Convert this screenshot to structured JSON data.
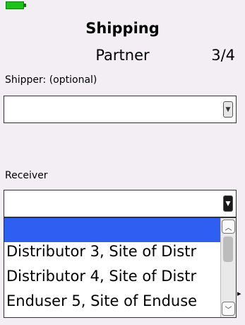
{
  "status": {
    "battery_color": "#19c419"
  },
  "header": {
    "title": "Shipping",
    "subtitle": "Partner",
    "page_indicator": "3/4"
  },
  "shipper": {
    "label": "Shipper: (optional)",
    "value": ""
  },
  "receiver": {
    "label": "Receiver",
    "value": ""
  },
  "dropdown": {
    "options": [
      "",
      "Distributor 3, Site of Distr",
      "Distributor 4, Site of Distr",
      "Enduser 5, Site of Enduse"
    ],
    "selected_index": 0,
    "selected_color": "#2f5ff2"
  },
  "icons": {
    "dropdown_arrow": "▼",
    "scroll_up": "︿",
    "scroll_down": "﹀",
    "caret": "▸"
  }
}
